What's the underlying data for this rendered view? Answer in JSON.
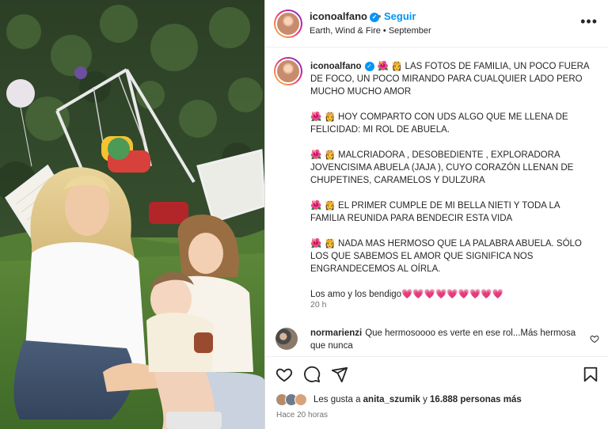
{
  "header": {
    "username": "iconoalfano",
    "follow_label": "Seguir",
    "subline": "Earth, Wind & Fire • September",
    "separator": "•",
    "more_icon": "more-horizontal-icon"
  },
  "caption": {
    "username": "iconoalfano",
    "paragraphs": [
      "🌺 👸 LAS FOTOS DE FAMILIA, UN POCO FUERA DE FOCO, UN POCO MIRANDO PARA CUALQUIER LADO PERO MUCHO MUCHO AMOR",
      "🌺 👸 HOY COMPARTO CON UDS ALGO QUE ME LLENA DE FELICIDAD: MI ROL DE ABUELA.",
      "🌺 👸 MALCRIADORA , DESOBEDIENTE , EXPLORADORA JOVENCISIMA ABUELA (JAJA ), CUYO CORAZÓN LLENAN DE CHUPETINES, CARAMELOS Y DULZURA",
      "🌺 👸 EL PRIMER CUMPLE DE MI BELLA NIETI Y TODA LA FAMILIA REUNIDA PARA BENDECIR ESTA VIDA",
      "🌺 👸 NADA MAS HERMOSO QUE LA PALABRA ABUELA. SÓLO LOS QUE SABEMOS EL AMOR QUE SIGNIFICA NOS ENGRANDECEMOS AL OÍRLA.",
      "Los amo y los bendigo💗💗💗💗💗💗💗💗💗"
    ],
    "time": "20 h"
  },
  "comment": {
    "username": "normarienzi",
    "text": "Que hermosoooo es verte en ese rol...Más hermosa que nunca"
  },
  "actions": {
    "icons": [
      "heart-icon",
      "comment-icon",
      "share-icon",
      "bookmark-icon"
    ]
  },
  "likes": {
    "prefix": "Les gusta a ",
    "user": "anita_szumik",
    "middle": " y ",
    "count": "16.888 personas más",
    "time": "Hace 20 horas"
  },
  "colors": {
    "accent": "#0095f6",
    "text": "#262626",
    "muted": "#737373",
    "border": "#dbdbdb"
  }
}
